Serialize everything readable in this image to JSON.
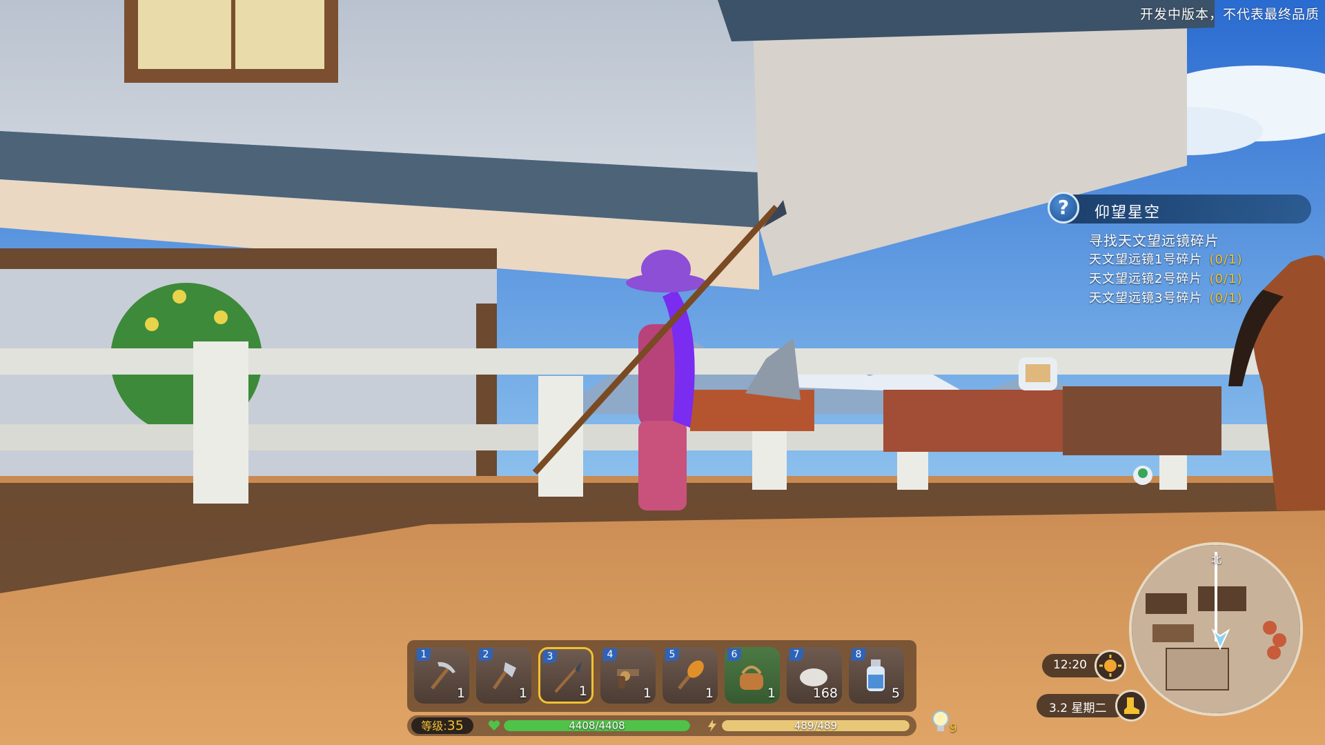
{
  "watermark": "开发中版本，不代表最终品质",
  "quest": {
    "icon": "question-mark-icon",
    "title": "仰望星空",
    "objective": "寻找天文望远镜碎片",
    "tasks": [
      {
        "label": "天文望远镜1号碎片",
        "progress": "(0/1)"
      },
      {
        "label": "天文望远镜2号碎片",
        "progress": "(0/1)"
      },
      {
        "label": "天文望远镜3号碎片",
        "progress": "(0/1)"
      }
    ]
  },
  "hotbar": {
    "selected_slot": 3,
    "slots": [
      {
        "key": "1",
        "icon": "pickaxe-icon",
        "count": "1"
      },
      {
        "key": "2",
        "icon": "axe-icon",
        "count": "1"
      },
      {
        "key": "3",
        "icon": "spear-icon",
        "count": "1"
      },
      {
        "key": "4",
        "icon": "revolver-icon",
        "count": "1"
      },
      {
        "key": "5",
        "icon": "torch-icon",
        "count": "1"
      },
      {
        "key": "6",
        "icon": "basket-icon",
        "count": "1"
      },
      {
        "key": "7",
        "icon": "stone-icon",
        "count": "168"
      },
      {
        "key": "8",
        "icon": "milk-bottle-icon",
        "count": "5"
      }
    ]
  },
  "status": {
    "level_label": "等级:",
    "level_value": "35",
    "health_text": "4408/4408",
    "health_fraction": 1.0,
    "stamina_text": "489/489",
    "stamina_fraction": 1.0,
    "hint_icon": "lightbulb-icon",
    "hint_count": "9"
  },
  "clock": {
    "time": "12:20",
    "time_icon": "sun-icon",
    "date": "3.2 星期二",
    "date_icon": "boot-icon"
  },
  "minimap": {
    "north_label": "北"
  },
  "colors": {
    "accent_gold": "#f2c230",
    "health_green": "#4fc24a",
    "stamina_yellow": "#e8c878",
    "quest_blue": "#1c4f8f"
  }
}
